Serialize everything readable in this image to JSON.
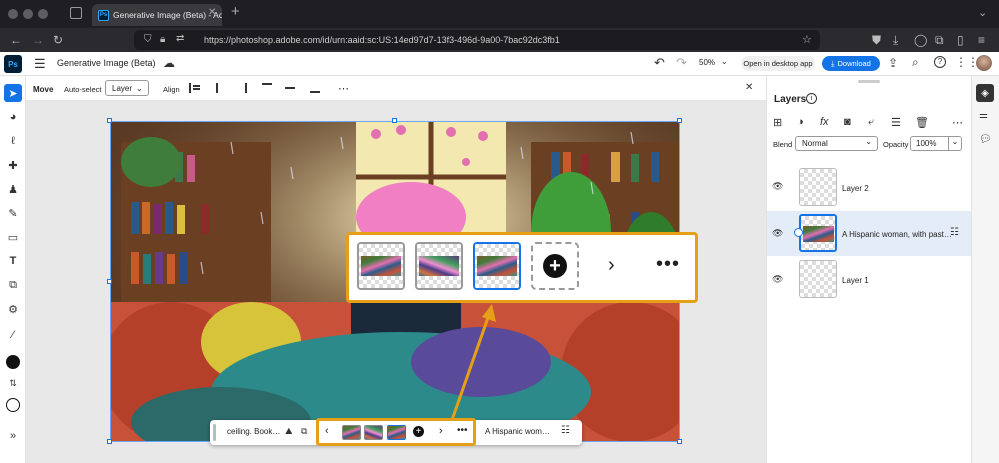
{
  "browser": {
    "tab_title": "Generative Image (Beta) - Adob…",
    "url": "https://photoshop.adobe.com/id/urn:aaid:sc:US:14ed97d7-13f3-496d-9a00-7bac92dc3fb1"
  },
  "app": {
    "logo": "Ps",
    "doc_title": "Generative Image (Beta)",
    "zoom": "50%",
    "open_desktop_label": "Open in desktop app",
    "download_label": "Download"
  },
  "options": {
    "move_label": "Move",
    "autoselect_label": "Auto-select",
    "layer_select": "Layer",
    "align_label": "Align"
  },
  "layers_panel": {
    "title": "Layers",
    "blend_label": "Blend",
    "blend_value": "Normal",
    "opacity_label": "Opacity",
    "opacity_value": "100%",
    "layers": [
      {
        "name": "Layer 2"
      },
      {
        "name": "A Hispanic woman, with past…"
      },
      {
        "name": "Layer 1"
      }
    ]
  },
  "taskbar": {
    "prompt_text": "ceiling. Book…",
    "layer_text": "A Hispanic wom…"
  },
  "colors": {
    "accent": "#1473e6",
    "highlight": "#e5a017",
    "ps_dark": "#001e36",
    "ps_blue": "#31a8ff"
  }
}
